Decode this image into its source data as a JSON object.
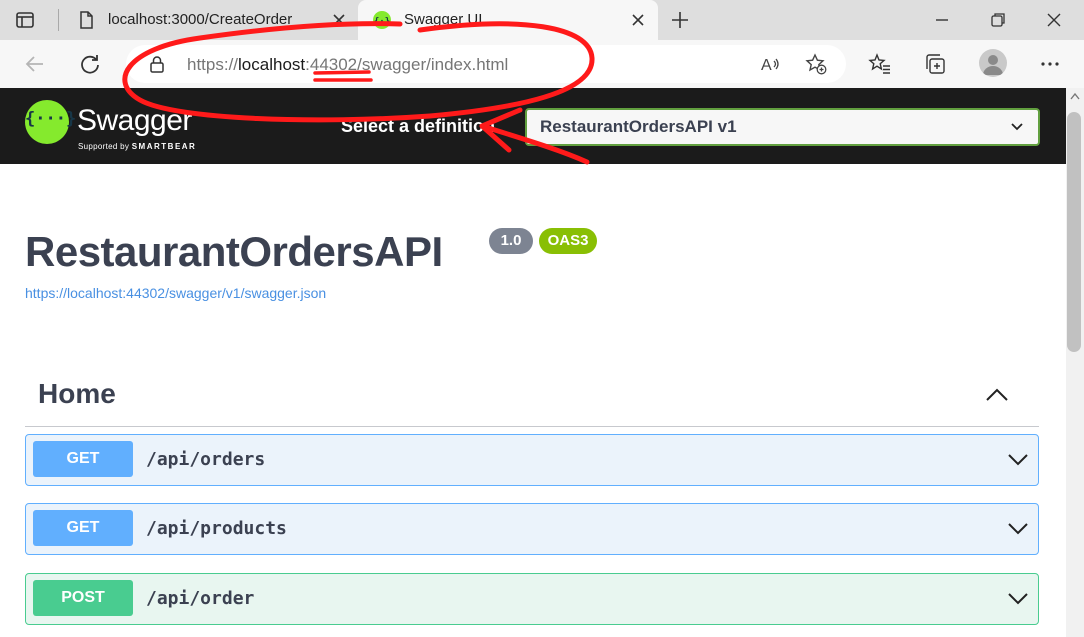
{
  "browser": {
    "tabs": [
      {
        "title": "localhost:3000/CreateOrder",
        "active": false
      },
      {
        "title": "Swagger UI",
        "active": true
      }
    ],
    "address": {
      "scheme": "https://",
      "host": "localhost",
      "port": ":44302",
      "path": "/swagger/index.html"
    }
  },
  "swagger": {
    "brand": "Swagger",
    "brand_sub_prefix": "Supported by ",
    "brand_sub_name": "SMARTBEAR",
    "definition_label": "Select a definition",
    "definition_value": "RestaurantOrdersAPI v1",
    "logo_glyph": "{···}"
  },
  "api": {
    "title": "RestaurantOrdersAPI",
    "version": "1.0",
    "oas": "OAS3",
    "spec_url": "https://localhost:44302/swagger/v1/swagger.json"
  },
  "section": {
    "title": "Home",
    "expanded": true,
    "operations": [
      {
        "method": "GET",
        "path": "/api/orders"
      },
      {
        "method": "GET",
        "path": "/api/products"
      },
      {
        "method": "POST",
        "path": "/api/order"
      }
    ]
  },
  "colors": {
    "get": "#61affe",
    "post": "#49cc90",
    "annotation": "#ff1a1a",
    "swagger_green": "#85ea2d"
  }
}
